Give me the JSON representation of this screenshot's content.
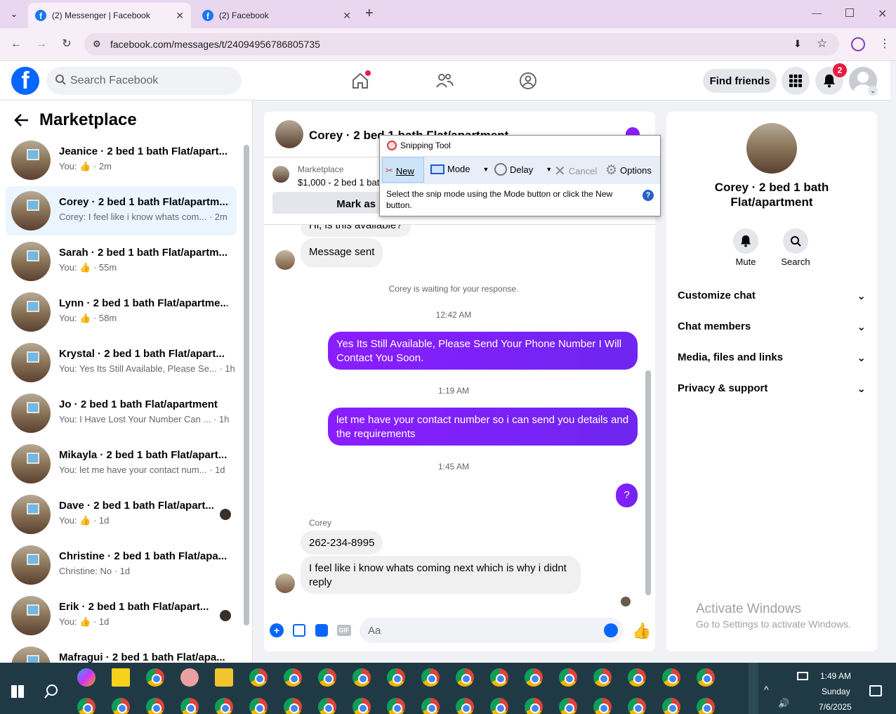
{
  "browser": {
    "tabs": [
      {
        "label": "(2) Messenger | Facebook"
      },
      {
        "label": "(2) Facebook"
      }
    ],
    "url": "facebook.com/messages/t/24094956786805735"
  },
  "header": {
    "search_placeholder": "Search Facebook",
    "find_friends": "Find friends",
    "notif_count": "2"
  },
  "sidebar": {
    "title": "Marketplace",
    "items": [
      {
        "name": "Jeanice · 2 bed 1 bath Flat/apart...",
        "sub": "You: 👍 · 2m"
      },
      {
        "name": "Corey · 2 bed 1 bath Flat/apartm...",
        "sub": "Corey: I feel like i know whats com... · 2m"
      },
      {
        "name": "Sarah · 2 bed 1 bath Flat/apartm...",
        "sub": "You: 👍 · 55m"
      },
      {
        "name": "Lynn · 2 bed 1 bath Flat/apartme...",
        "sub": "You: 👍 · 58m"
      },
      {
        "name": "Krystal · 2 bed 1 bath Flat/apart...",
        "sub": "You: Yes Its Still Available, Please Se... · 1h"
      },
      {
        "name": "Jo · 2 bed 1 bath Flat/apartment",
        "sub": "You: I Have Lost Your Number Can ... · 1h"
      },
      {
        "name": "Mikayla · 2 bed 1 bath Flat/apart...",
        "sub": "You: let me have your contact num... · 1d"
      },
      {
        "name": "Dave · 2 bed 1 bath Flat/apart...",
        "sub": "You: 👍 · 1d"
      },
      {
        "name": "Christine · 2 bed 1 bath Flat/apa...",
        "sub": "Christine: No · 1d"
      },
      {
        "name": "Erik · 2 bed 1 bath Flat/apart...",
        "sub": "You: 👍 · 1d"
      },
      {
        "name": "Mafragui · 2 bed 1 bath Flat/apa...",
        "sub": ""
      }
    ]
  },
  "chat": {
    "title": "Corey · 2 bed 1 bath Flat/apartment",
    "listing_source": "Marketplace",
    "listing_price": "$1,000 - 2 bed 1 bat",
    "mark_as": "Mark as pe",
    "partial_msg": "Hi, is this available?",
    "msg_sent": "Message sent",
    "waiting": "Corey is waiting for your response.",
    "t1": "12:42 AM",
    "out1": "Yes Its Still Available, Please Send Your Phone Number I Will Contact You Soon.",
    "t2": "1:19 AM",
    "out2": "let me have your contact number so i can send you details and the requirements",
    "t3": "1:45 AM",
    "out3": "?",
    "sender": "Corey",
    "in1": "262-234-8995",
    "in2": "I feel like i know whats coming next which is why i didnt reply",
    "composer_placeholder": "Aa"
  },
  "snipping": {
    "title": "Snipping Tool",
    "new": "New",
    "mode": "Mode",
    "delay": "Delay",
    "cancel": "Cancel",
    "options": "Options",
    "hint": "Select the snip mode using the Mode button or click the New button."
  },
  "details": {
    "title": "Corey · 2 bed 1 bath Flat/apartment",
    "mute": "Mute",
    "search": "Search",
    "sections": [
      "Customize chat",
      "Chat members",
      "Media, files and links",
      "Privacy & support"
    ]
  },
  "watermark": {
    "line1": "Activate Windows",
    "line2": "Go to Settings to activate Windows."
  },
  "taskbar": {
    "time": "1:49 AM",
    "day": "Sunday",
    "date": "7/6/2025"
  }
}
